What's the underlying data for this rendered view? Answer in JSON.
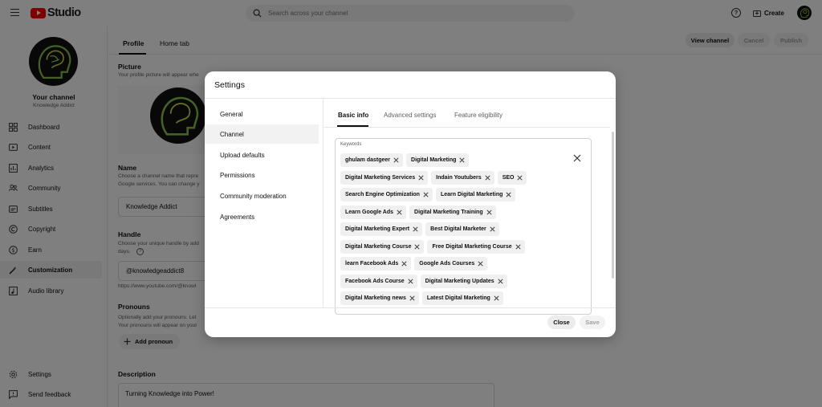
{
  "app": {
    "logo_text": "Studio"
  },
  "topbar": {
    "search_placeholder": "Search across your channel",
    "create_label": "Create"
  },
  "channel": {
    "title": "Your channel",
    "name": "Knowledge Addict"
  },
  "sidebar": {
    "items": [
      {
        "label": "Dashboard",
        "icon": "dashboard-icon"
      },
      {
        "label": "Content",
        "icon": "content-icon"
      },
      {
        "label": "Analytics",
        "icon": "analytics-icon"
      },
      {
        "label": "Community",
        "icon": "community-icon"
      },
      {
        "label": "Subtitles",
        "icon": "subtitles-icon"
      },
      {
        "label": "Copyright",
        "icon": "copyright-icon"
      },
      {
        "label": "Earn",
        "icon": "earn-icon"
      },
      {
        "label": "Customization",
        "icon": "customization-icon",
        "active": true
      },
      {
        "label": "Audio library",
        "icon": "audio-library-icon"
      }
    ],
    "bottom": [
      {
        "label": "Settings",
        "icon": "gear-icon"
      },
      {
        "label": "Send feedback",
        "icon": "feedback-icon"
      }
    ]
  },
  "page": {
    "tabs": [
      "Profile",
      "Home tab"
    ],
    "actions": {
      "view": "View channel",
      "cancel": "Cancel",
      "publish": "Publish"
    },
    "picture": {
      "heading": "Picture",
      "desc": "Your profile picture will appear whe"
    },
    "name": {
      "heading": "Name",
      "desc1": "Choose a channel name that repre",
      "desc2": "Google services. You can change y",
      "value": "Knowledge Addict"
    },
    "handle": {
      "heading": "Handle",
      "desc1": "Choose your unique handle by add",
      "desc2": "days.",
      "value": "@knowledgeaddict8",
      "url": "https://www.youtube.com/@knowl"
    },
    "pronouns": {
      "heading": "Pronouns",
      "desc1": "Optionally add your pronouns. Let",
      "desc2": "Your pronouns will appear on your",
      "add_label": "Add pronoun"
    },
    "description": {
      "heading": "Description",
      "value": "Turning Knowledge into Power!"
    }
  },
  "modal": {
    "title": "Settings",
    "nav": [
      "General",
      "Channel",
      "Upload defaults",
      "Permissions",
      "Community moderation",
      "Agreements"
    ],
    "active_nav": "Channel",
    "tabs": [
      "Basic info",
      "Advanced settings",
      "Feature eligibility"
    ],
    "active_tab": "Basic info",
    "keywords_label": "Keywords",
    "keyword_rows": [
      [
        "ghulam dastgeer",
        "Digital Marketing"
      ],
      [
        "Digital Marketing Services",
        "Indain Youtubers",
        "SEO"
      ],
      [
        "Search Engine Optimization",
        "Learn Digital Marketing"
      ],
      [
        "Learn Google Ads",
        "Digital Marketing Training"
      ],
      [
        "Digital Marketing Expert",
        "Best Digital Marketer"
      ],
      [
        "Digital Marketing Course",
        "Free Digital Marketing Course"
      ],
      [
        "learn Facebook Ads",
        "Google Ads Courses"
      ],
      [
        "Facebook Ads Course",
        "Digital Marketing Updates"
      ],
      [
        "Digital Marketing news",
        "Latest Digital Marketing"
      ]
    ],
    "close_label": "Close",
    "save_label": "Save"
  }
}
